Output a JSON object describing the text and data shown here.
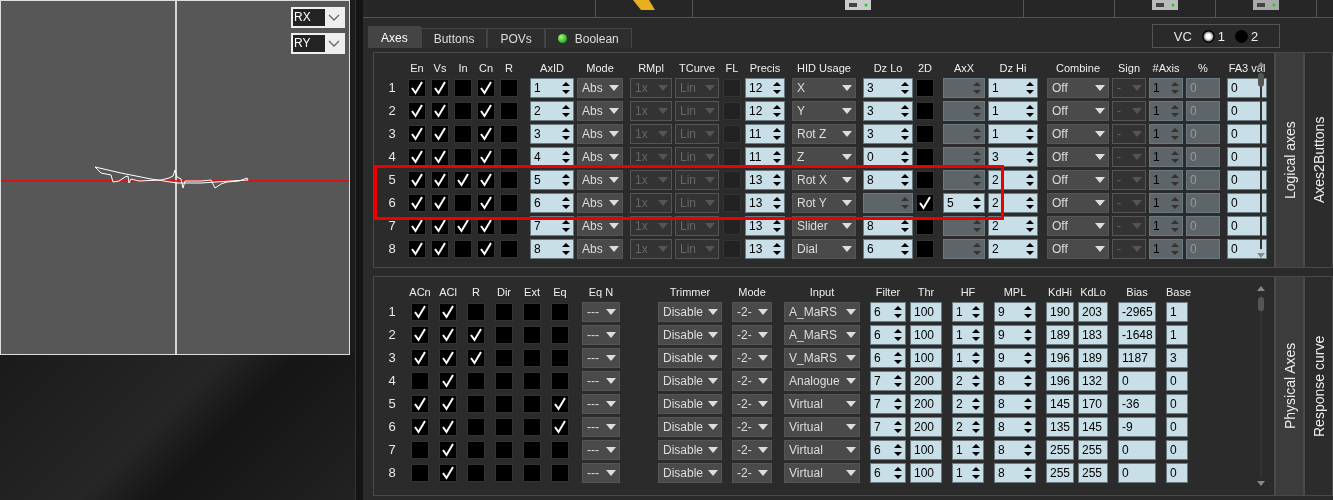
{
  "plot": {
    "selects": [
      "RX",
      "RY"
    ]
  },
  "tabs": [
    {
      "label": "Axes",
      "selected": true,
      "indicator": false
    },
    {
      "label": "Buttons",
      "selected": false,
      "indicator": false
    },
    {
      "label": "POVs",
      "selected": false,
      "indicator": false
    },
    {
      "label": "Boolean",
      "selected": false,
      "indicator": true
    }
  ],
  "vc": {
    "label": "VC",
    "options": [
      {
        "label": "1",
        "selected": true
      },
      {
        "label": "2",
        "selected": false
      }
    ]
  },
  "logical_axes": {
    "columns": [
      {
        "label": "En",
        "disabled": false
      },
      {
        "label": "Vs",
        "disabled": false
      },
      {
        "label": "In",
        "disabled": false
      },
      {
        "label": "Cn",
        "disabled": false
      },
      {
        "label": "R",
        "disabled": false
      },
      {
        "label": "AxID",
        "disabled": false
      },
      {
        "label": "Mode",
        "disabled": false
      },
      {
        "label": "RMpl",
        "disabled": true
      },
      {
        "label": "TCurve",
        "disabled": true
      },
      {
        "label": "FL",
        "disabled": true
      },
      {
        "label": "Precis",
        "disabled": false
      },
      {
        "label": "HID Usage",
        "disabled": false
      },
      {
        "label": "Dz Lo",
        "disabled": false
      },
      {
        "label": "2D",
        "disabled": false
      },
      {
        "label": "AxX",
        "disabled": false
      },
      {
        "label": "Dz Hi",
        "disabled": false
      },
      {
        "label": "Combine",
        "disabled": false
      },
      {
        "label": "Sign",
        "disabled": true
      },
      {
        "label": "#Axis",
        "disabled": true
      },
      {
        "label": "%",
        "disabled": true
      },
      {
        "label": "FA3 val",
        "disabled": false
      }
    ],
    "rows": [
      {
        "number": "1",
        "highlighted": false,
        "en": true,
        "vs": true,
        "in": false,
        "cn": true,
        "r": false,
        "axid": "1",
        "mode": "Abs",
        "rmpl": "1x",
        "tcurve": "Lin",
        "fl": false,
        "precis": "12",
        "hid_usage": "X",
        "dz_lo": "3",
        "dz_lo_disabled": false,
        "two_d": false,
        "axx_disabled": true,
        "dz_hi": "1",
        "combine": "Off",
        "sign": "-",
        "axis_count": "1",
        "percent": "0",
        "fa3_val": "0"
      },
      {
        "number": "2",
        "highlighted": false,
        "en": true,
        "vs": true,
        "in": false,
        "cn": true,
        "r": false,
        "axid": "2",
        "mode": "Abs",
        "rmpl": "1x",
        "tcurve": "Lin",
        "fl": false,
        "precis": "12",
        "hid_usage": "Y",
        "dz_lo": "3",
        "dz_lo_disabled": false,
        "two_d": false,
        "axx_disabled": true,
        "dz_hi": "1",
        "combine": "Off",
        "sign": "-",
        "axis_count": "1",
        "percent": "0",
        "fa3_val": "0"
      },
      {
        "number": "3",
        "highlighted": false,
        "en": true,
        "vs": true,
        "in": false,
        "cn": true,
        "r": false,
        "axid": "3",
        "mode": "Abs",
        "rmpl": "1x",
        "tcurve": "Lin",
        "fl": false,
        "precis": "11",
        "hid_usage": "Rot Z",
        "dz_lo": "3",
        "dz_lo_disabled": false,
        "two_d": false,
        "axx_disabled": true,
        "dz_hi": "1",
        "combine": "Off",
        "sign": "-",
        "axis_count": "1",
        "percent": "0",
        "fa3_val": "0"
      },
      {
        "number": "4",
        "highlighted": false,
        "en": true,
        "vs": true,
        "in": false,
        "cn": true,
        "r": false,
        "axid": "4",
        "mode": "Abs",
        "rmpl": "1x",
        "tcurve": "Lin",
        "fl": false,
        "precis": "11",
        "hid_usage": "Z",
        "dz_lo": "0",
        "dz_lo_disabled": false,
        "two_d": false,
        "axx_disabled": true,
        "dz_hi": "3",
        "combine": "Off",
        "sign": "-",
        "axis_count": "1",
        "percent": "0",
        "fa3_val": "0"
      },
      {
        "number": "5",
        "highlighted": true,
        "en": true,
        "vs": true,
        "in": true,
        "cn": true,
        "r": false,
        "axid": "5",
        "mode": "Abs",
        "rmpl": "1x",
        "tcurve": "Lin",
        "fl": false,
        "precis": "13",
        "hid_usage": "Rot X",
        "dz_lo": "8",
        "dz_lo_disabled": false,
        "two_d": false,
        "axx_disabled": true,
        "dz_hi": "2",
        "combine": "Off",
        "sign": "-",
        "axis_count": "1",
        "percent": "0",
        "fa3_val": "0"
      },
      {
        "number": "6",
        "highlighted": true,
        "en": true,
        "vs": true,
        "in": false,
        "cn": true,
        "r": false,
        "axid": "6",
        "mode": "Abs",
        "rmpl": "1x",
        "tcurve": "Lin",
        "fl": false,
        "precis": "13",
        "hid_usage": "Rot Y",
        "dz_lo_disabled": true,
        "two_d": true,
        "axx": "5",
        "axx_disabled": false,
        "dz_hi": "2",
        "combine": "Off",
        "sign": "-",
        "axis_count": "1",
        "percent": "0",
        "fa3_val": "0"
      },
      {
        "number": "7",
        "highlighted": false,
        "en": true,
        "vs": true,
        "in": true,
        "cn": true,
        "r": false,
        "axid": "7",
        "mode": "Abs",
        "rmpl": "1x",
        "tcurve": "Lin",
        "fl": false,
        "precis": "13",
        "hid_usage": "Slider",
        "dz_lo": "8",
        "dz_lo_disabled": false,
        "two_d": false,
        "axx_disabled": true,
        "dz_hi": "2",
        "combine": "Off",
        "sign": "-",
        "axis_count": "1",
        "percent": "0",
        "fa3_val": "0"
      },
      {
        "number": "8",
        "highlighted": false,
        "en": true,
        "vs": true,
        "in": false,
        "cn": true,
        "r": false,
        "axid": "8",
        "mode": "Abs",
        "rmpl": "1x",
        "tcurve": "Lin",
        "fl": false,
        "precis": "13",
        "hid_usage": "Dial",
        "dz_lo": "6",
        "dz_lo_disabled": false,
        "two_d": false,
        "axx_disabled": true,
        "dz_hi": "2",
        "combine": "Off",
        "sign": "-",
        "axis_count": "1",
        "percent": "0",
        "fa3_val": "0"
      }
    ]
  },
  "logical_side_tabs": [
    {
      "label": "Logical axes",
      "selected": true
    },
    {
      "label": "Axes2Buttons",
      "selected": false
    }
  ],
  "physical_axes": {
    "columns": [
      {
        "label": "ACn",
        "disabled": false
      },
      {
        "label": "ACl",
        "disabled": false
      },
      {
        "label": "R",
        "disabled": false
      },
      {
        "label": "Dir",
        "disabled": false
      },
      {
        "label": "Ext",
        "disabled": false
      },
      {
        "label": "Eq",
        "disabled": false
      },
      {
        "label": "Eq N",
        "disabled": false
      },
      {
        "label": "Trimmer",
        "disabled": false
      },
      {
        "label": "Mode",
        "disabled": false
      },
      {
        "label": "Input",
        "disabled": false
      },
      {
        "label": "Filter",
        "disabled": false
      },
      {
        "label": "Thr",
        "disabled": false
      },
      {
        "label": "HF",
        "disabled": false
      },
      {
        "label": "MPL",
        "disabled": false
      },
      {
        "label": "KdHi",
        "disabled": false
      },
      {
        "label": "KdLo",
        "disabled": false
      },
      {
        "label": "Bias",
        "disabled": false
      },
      {
        "label": "Base",
        "disabled": false
      }
    ],
    "rows": [
      {
        "number": "1",
        "acn": true,
        "acl": true,
        "r": false,
        "dir": false,
        "ext": false,
        "eq": false,
        "eq_n": "---",
        "trimmer": "Disable",
        "mode": "-2-",
        "input": "A_MaRS",
        "filter": "6",
        "thr": "100",
        "hf": "1",
        "mpl": "9",
        "kdhi": "190",
        "kdlo": "203",
        "bias": "-2965",
        "base": "1"
      },
      {
        "number": "2",
        "acn": true,
        "acl": true,
        "r": true,
        "dir": false,
        "ext": false,
        "eq": false,
        "eq_n": "---",
        "trimmer": "Disable",
        "mode": "-2-",
        "input": "A_MaRS",
        "filter": "6",
        "thr": "100",
        "hf": "1",
        "mpl": "9",
        "kdhi": "189",
        "kdlo": "183",
        "bias": "-1648",
        "base": "1"
      },
      {
        "number": "3",
        "acn": true,
        "acl": true,
        "r": true,
        "dir": false,
        "ext": false,
        "eq": false,
        "eq_n": "---",
        "trimmer": "Disable",
        "mode": "-2-",
        "input": "V_MaRS",
        "filter": "6",
        "thr": "100",
        "hf": "1",
        "mpl": "9",
        "kdhi": "196",
        "kdlo": "189",
        "bias": "1187",
        "base": "3"
      },
      {
        "number": "4",
        "acn": false,
        "acl": true,
        "r": false,
        "dir": false,
        "ext": false,
        "eq": false,
        "eq_n": "---",
        "trimmer": "Disable",
        "mode": "-2-",
        "input": "Analogue",
        "filter": "7",
        "thr": "200",
        "hf": "2",
        "mpl": "8",
        "kdhi": "196",
        "kdlo": "132",
        "bias": "0",
        "base": "0"
      },
      {
        "number": "5",
        "acn": true,
        "acl": true,
        "r": false,
        "dir": false,
        "ext": false,
        "eq": true,
        "eq_n": "---",
        "trimmer": "Disable",
        "mode": "-2-",
        "input": "Virtual",
        "filter": "7",
        "thr": "200",
        "hf": "2",
        "mpl": "8",
        "kdhi": "145",
        "kdlo": "170",
        "bias": "-36",
        "base": "0"
      },
      {
        "number": "6",
        "acn": true,
        "acl": true,
        "r": false,
        "dir": false,
        "ext": false,
        "eq": true,
        "eq_n": "---",
        "trimmer": "Disable",
        "mode": "-2-",
        "input": "Virtual",
        "filter": "7",
        "thr": "200",
        "hf": "2",
        "mpl": "8",
        "kdhi": "135",
        "kdlo": "145",
        "bias": "-9",
        "base": "0"
      },
      {
        "number": "7",
        "acn": false,
        "acl": true,
        "r": false,
        "dir": false,
        "ext": false,
        "eq": false,
        "eq_n": "---",
        "trimmer": "Disable",
        "mode": "-2-",
        "input": "Virtual",
        "filter": "6",
        "thr": "100",
        "hf": "1",
        "mpl": "8",
        "kdhi": "255",
        "kdlo": "255",
        "bias": "0",
        "base": "0"
      },
      {
        "number": "8",
        "acn": false,
        "acl": true,
        "r": false,
        "dir": false,
        "ext": false,
        "eq": false,
        "eq_n": "---",
        "trimmer": "Disable",
        "mode": "-2-",
        "input": "Virtual",
        "filter": "6",
        "thr": "100",
        "hf": "1",
        "mpl": "8",
        "kdhi": "255",
        "kdlo": "255",
        "bias": "0",
        "base": "0"
      }
    ]
  },
  "physical_side_tabs": [
    {
      "label": "Physical Axes",
      "selected": true
    },
    {
      "label": "Response curve",
      "selected": false
    }
  ]
}
